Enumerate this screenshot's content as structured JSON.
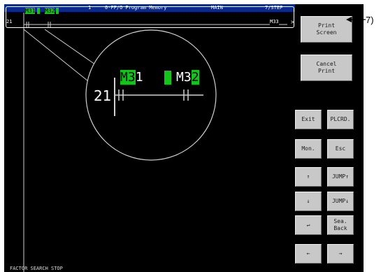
{
  "title_bar": {
    "num": "1",
    "name": "0-FF/O Program Memory",
    "block": "MAIN",
    "step": "7/STEP"
  },
  "ladder": {
    "step_number": "21",
    "contacts_top": [
      "M31",
      "M32"
    ],
    "coil": "M33",
    "arrow": ">"
  },
  "zoom": {
    "step_number": "21",
    "contact1": {
      "prefix": "M3",
      "suffix": "1"
    },
    "contact2": {
      "prefix": "M3",
      "suffix": "2"
    }
  },
  "buttons": {
    "print_screen": "Print\nScreen",
    "cancel_print": "Cancel\nPrint",
    "exit": "Exit",
    "plcrd": "PLCRD.",
    "mon": "Mon.",
    "esc": "Esc",
    "up": "↑",
    "jump_up": "JUMP↑",
    "down": "↓",
    "jump_down": "JUMP↓",
    "enter": "↵",
    "sea_back": "Sea.\nBack",
    "left": "←",
    "right": "→"
  },
  "status": "FACTOR SEARCH STOP",
  "callout_label": "7)",
  "colors": {
    "screen": "#000000",
    "title": "#0b2a8a",
    "highlight": "#13c41b",
    "button": "#c8c8c8"
  }
}
